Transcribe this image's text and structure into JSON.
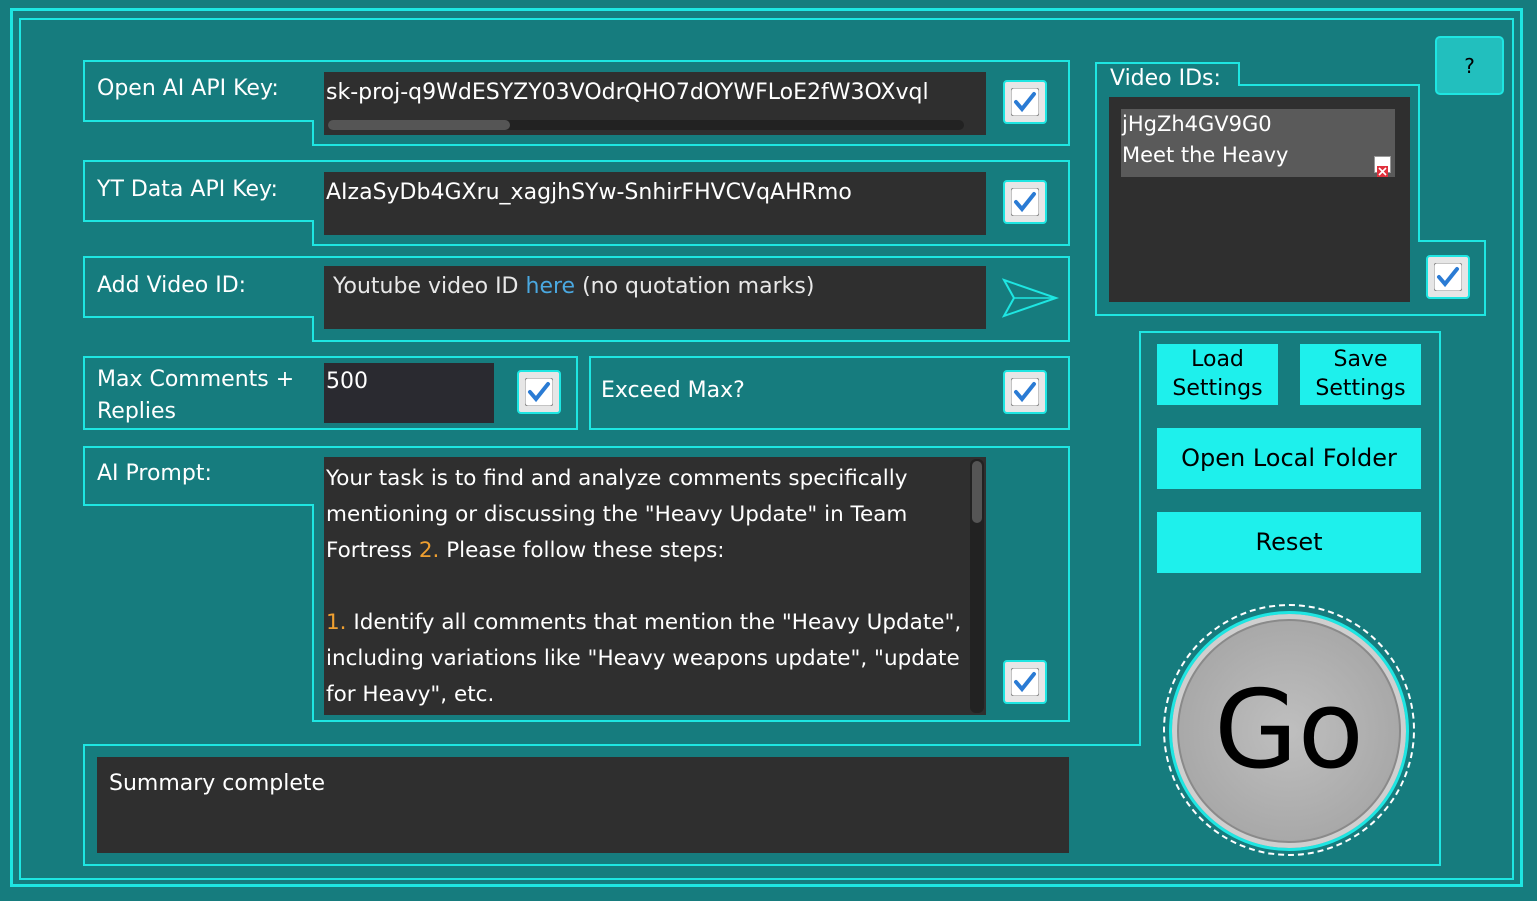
{
  "fields": {
    "openai_label": "Open AI API Key:",
    "openai_value": "sk-proj-q9WdESYZY03VOdrQHO7dOYWFLoE2fW3OXvql",
    "yt_label": "YT Data API Key:",
    "yt_value": "AIzaSyDb4GXru_xagjhSYw-SnhirFHVCVqAHRmo",
    "add_label": "Add Video ID:",
    "add_placeholder_a": "Youtube video ID ",
    "add_placeholder_link": "here",
    "add_placeholder_b": " (no quotation marks)",
    "max_label": "Max Comments + Replies",
    "max_value": "500",
    "exceed_label": "Exceed Max?",
    "prompt_label": "AI Prompt:"
  },
  "prompt": {
    "p1a": "Your task is to find and analyze comments specifically mentioning or discussing the \"Heavy Update\" in Team Fortress ",
    "p1num": "2.",
    "p1b": " Please follow these steps:",
    "step_num": "1.",
    "step_text": " Identify all comments that mention the \"Heavy Update\", including variations like \"Heavy weapons update\", \"update for Heavy\", etc."
  },
  "video_ids": {
    "label": "Video IDs:",
    "items": [
      {
        "id": "jHgZh4GV9G0",
        "title": "Meet the Heavy"
      }
    ]
  },
  "buttons": {
    "help": "?",
    "load": "Load Settings",
    "save": "Save Settings",
    "open_folder": "Open Local Folder",
    "reset": "Reset",
    "go": "Go"
  },
  "status": "Summary complete",
  "colors": {
    "background": "#167C7E",
    "accent": "#1EE6E2",
    "field": "#2F2F2F",
    "button": "#1EF0EC"
  },
  "icons": {
    "checkbox": "checkmark-icon",
    "send": "arrow-send-icon",
    "remove": "remove-icon"
  }
}
